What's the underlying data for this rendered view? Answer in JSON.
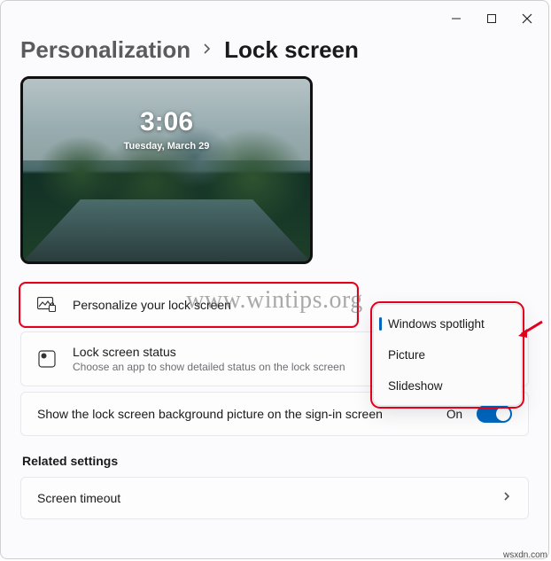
{
  "breadcrumb": {
    "parent": "Personalization",
    "current": "Lock screen"
  },
  "preview": {
    "time": "3:06",
    "date": "Tuesday, March 29"
  },
  "rows": {
    "personalize": {
      "title": "Personalize your lock screen"
    },
    "status": {
      "title": "Lock screen status",
      "sub": "Choose an app to show detailed status on the lock screen"
    },
    "signin": {
      "title": "Show the lock screen background picture on the sign-in screen",
      "state_label": "On"
    },
    "timeout": {
      "title": "Screen timeout"
    }
  },
  "dropdown": {
    "options": [
      "Windows spotlight",
      "Picture",
      "Slideshow"
    ],
    "selected_index": 0
  },
  "section": {
    "related": "Related settings"
  },
  "watermark": "www.wintips.org",
  "attribution": "wsxdn.com"
}
